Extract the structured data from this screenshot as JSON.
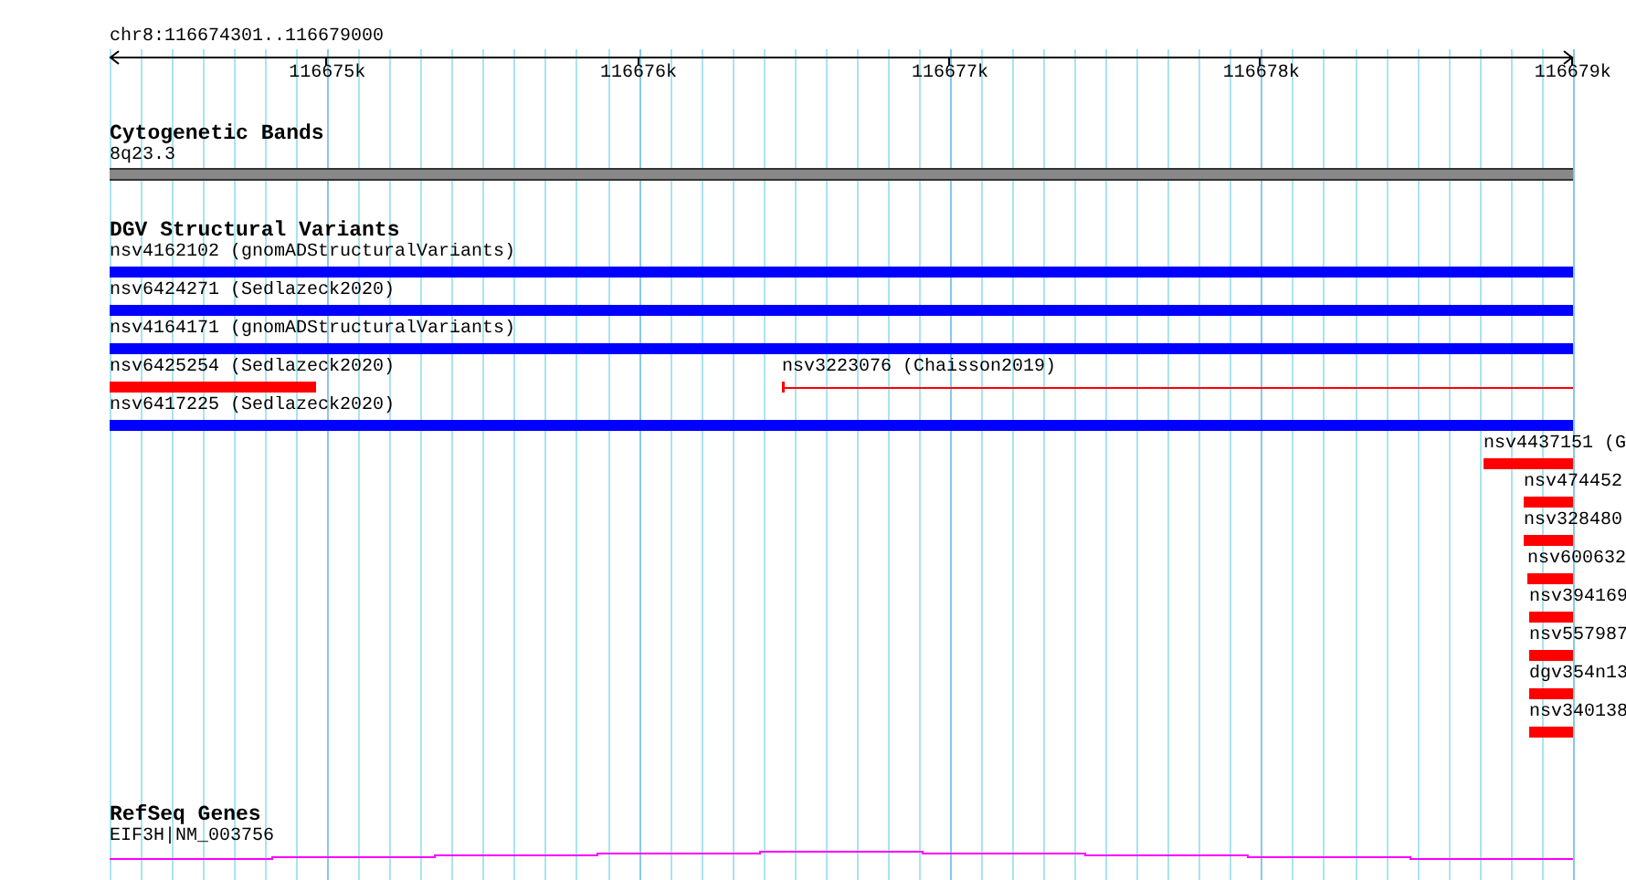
{
  "ruler": {
    "location": "chr8:116674301..116679000",
    "ticks": [
      "116675k",
      "116676k",
      "116677k",
      "116678k",
      "116679k"
    ]
  },
  "cytogenetic_track": {
    "title": "Cytogenetic Bands",
    "band": {
      "label": "8q23.3"
    }
  },
  "dgv_track": {
    "title": "DGV Structural Variants",
    "rows": [
      {
        "features": [
          {
            "label": "nsv4162102 (gnomADStructuralVariants)",
            "color": "#0000ff",
            "kind": "bar"
          }
        ]
      },
      {
        "features": [
          {
            "label": "nsv6424271 (Sedlazeck2020)",
            "color": "#0000ff",
            "kind": "bar"
          }
        ]
      },
      {
        "features": [
          {
            "label": "nsv4164171 (gnomADStructuralVariants)",
            "color": "#0000ff",
            "kind": "bar"
          }
        ]
      },
      {
        "features": [
          {
            "label": "nsv6425254 (Sedlazeck2020)",
            "color": "#ff0000",
            "kind": "bar"
          },
          {
            "label": "nsv3223076 (Chaisson2019)",
            "color": "#ff0000",
            "kind": "line"
          }
        ]
      },
      {
        "features": [
          {
            "label": "nsv6417225 (Sedlazeck2020)",
            "color": "#0000ff",
            "kind": "bar"
          }
        ]
      },
      {
        "features": [
          {
            "label": "nsv4437151 (G",
            "color": "#ff0000",
            "kind": "bar"
          }
        ]
      },
      {
        "features": [
          {
            "label": "nsv474452",
            "color": "#ff0000",
            "kind": "bar"
          }
        ]
      },
      {
        "features": [
          {
            "label": "nsv328480",
            "color": "#ff0000",
            "kind": "bar"
          }
        ]
      },
      {
        "features": [
          {
            "label": "nsv600632",
            "color": "#ff0000",
            "kind": "bar"
          }
        ]
      },
      {
        "features": [
          {
            "label": "nsv394169",
            "color": "#ff0000",
            "kind": "bar"
          }
        ]
      },
      {
        "features": [
          {
            "label": "nsv557987",
            "color": "#ff0000",
            "kind": "bar"
          }
        ]
      },
      {
        "features": [
          {
            "label": "dgv354n13",
            "color": "#ff0000",
            "kind": "bar"
          }
        ]
      },
      {
        "features": [
          {
            "label": "nsv340138",
            "color": "#ff0000",
            "kind": "bar"
          }
        ]
      }
    ]
  },
  "refseq_track": {
    "title": "RefSeq Genes",
    "gene": {
      "label": "EIF3H|NM_003756"
    }
  }
}
